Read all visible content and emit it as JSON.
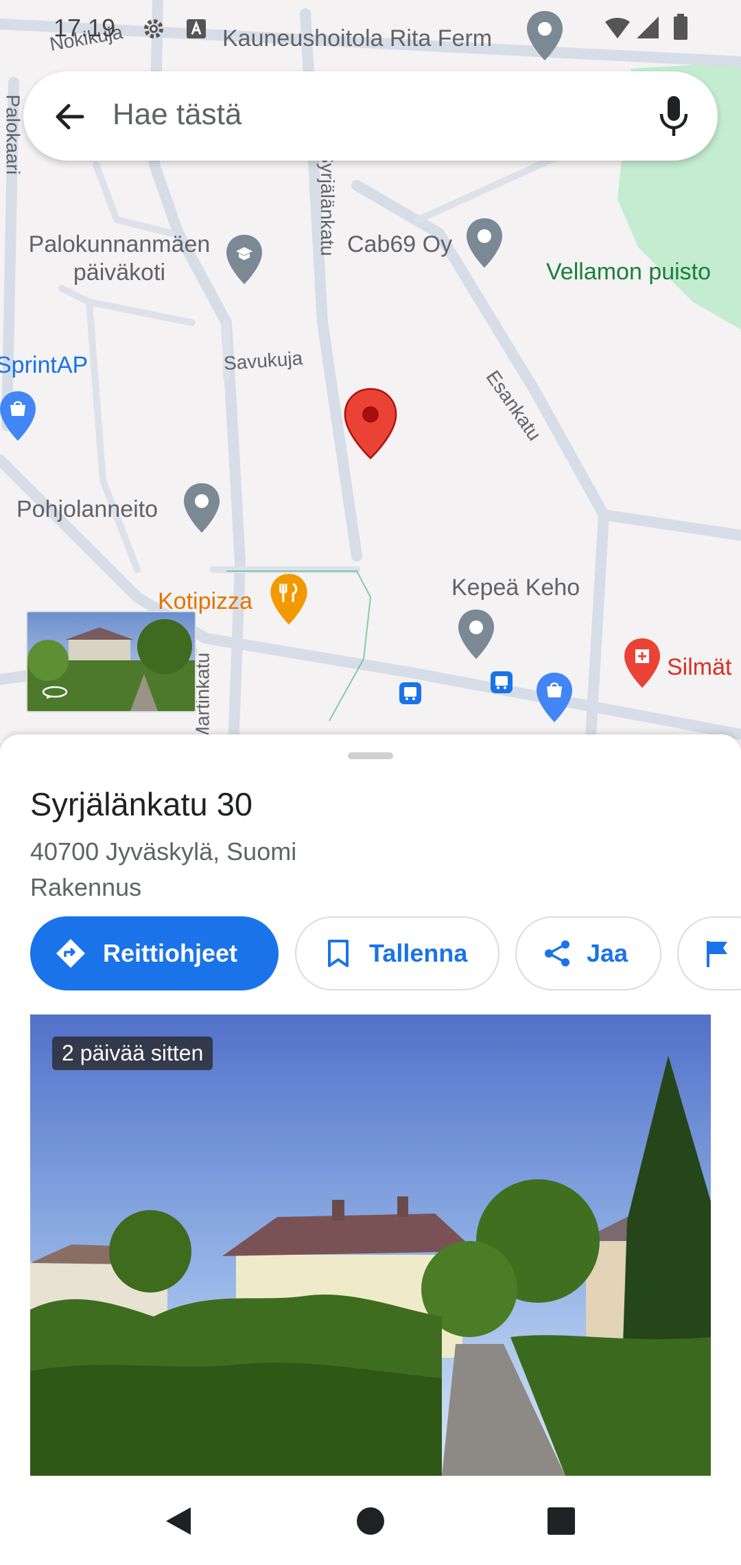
{
  "status_bar": {
    "time": "17.19"
  },
  "search": {
    "placeholder": "Hae tästä",
    "back_icon": "arrow-back-icon",
    "mic_icon": "mic-icon"
  },
  "map": {
    "streets": [
      "Nokikuja",
      "Palokaari",
      "Syrjälänkatu",
      "Savukuja",
      "Esankatu",
      "Martinkatu"
    ],
    "places": [
      {
        "name": "Kauneushoitola Rita Ferm",
        "icon": "pin-icon"
      },
      {
        "name": "Palokunnanmäen päiväkoti",
        "icon": "school-icon"
      },
      {
        "name": "Cab69 Oy",
        "icon": "pin-icon"
      },
      {
        "name": "Vellamon puisto",
        "icon": "park-icon"
      },
      {
        "name": "SprintAP",
        "icon": "shopping-icon"
      },
      {
        "name": "Pohjolanneito",
        "icon": "pin-icon"
      },
      {
        "name": "Kotipizza",
        "icon": "restaurant-icon"
      },
      {
        "name": "Kepeä Keho",
        "icon": "pin-icon"
      },
      {
        "name": "Silmät",
        "icon": "medical-icon"
      }
    ],
    "colors": {
      "park": "#c3ecd0",
      "road": "#d7dde6",
      "pin_red": "#ea4335",
      "poi_blue": "#4285f4",
      "food_orange": "#f29900"
    }
  },
  "place": {
    "title": "Syrjälänkatu 30",
    "address": "40700 Jyväskylä, Suomi",
    "category": "Rakennus"
  },
  "actions": {
    "directions": "Reittiohjeet",
    "save": "Tallenna",
    "share": "Jaa"
  },
  "photo": {
    "badge": "2 päivää sitten"
  },
  "colors": {
    "accent": "#1a73e8"
  }
}
